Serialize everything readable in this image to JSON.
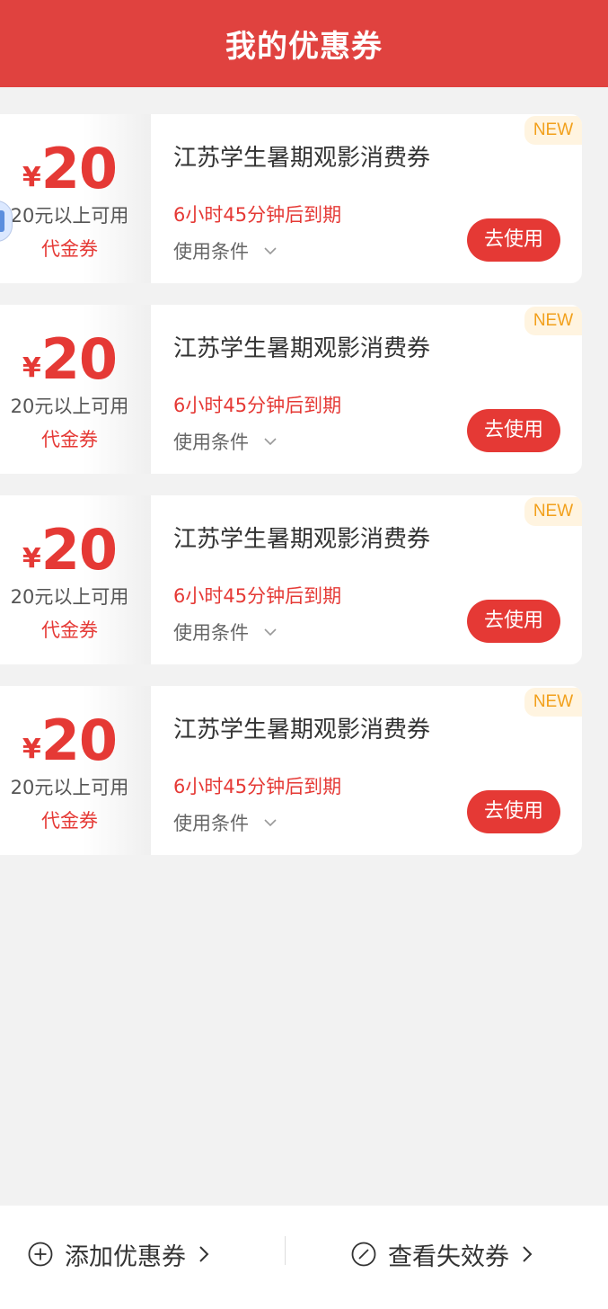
{
  "header": {
    "title": "我的优惠券"
  },
  "coupons": [
    {
      "currency": "¥",
      "amount": "20",
      "min_spend": "20元以上可用",
      "type": "代金券",
      "name": "江苏学生暑期观影消费券",
      "expiry": "6小时45分钟后到期",
      "conditions_label": "使用条件",
      "use_label": "去使用",
      "badge": "NEW"
    },
    {
      "currency": "¥",
      "amount": "20",
      "min_spend": "20元以上可用",
      "type": "代金券",
      "name": "江苏学生暑期观影消费券",
      "expiry": "6小时45分钟后到期",
      "conditions_label": "使用条件",
      "use_label": "去使用",
      "badge": "NEW"
    },
    {
      "currency": "¥",
      "amount": "20",
      "min_spend": "20元以上可用",
      "type": "代金券",
      "name": "江苏学生暑期观影消费券",
      "expiry": "6小时45分钟后到期",
      "conditions_label": "使用条件",
      "use_label": "去使用",
      "badge": "NEW"
    },
    {
      "currency": "¥",
      "amount": "20",
      "min_spend": "20元以上可用",
      "type": "代金券",
      "name": "江苏学生暑期观影消费券",
      "expiry": "6小时45分钟后到期",
      "conditions_label": "使用条件",
      "use_label": "去使用",
      "badge": "NEW"
    }
  ],
  "footer": {
    "add_label": "添加优惠券",
    "expired_label": "查看失效券"
  },
  "colors": {
    "brand_red": "#e0423f",
    "accent_red": "#e53935",
    "badge_orange": "#f2a01b"
  },
  "icons": {
    "add": "plus-circle-icon",
    "expired": "slash-circle-icon",
    "arrow": "chevron-right-icon",
    "expand": "chevron-down-icon"
  }
}
